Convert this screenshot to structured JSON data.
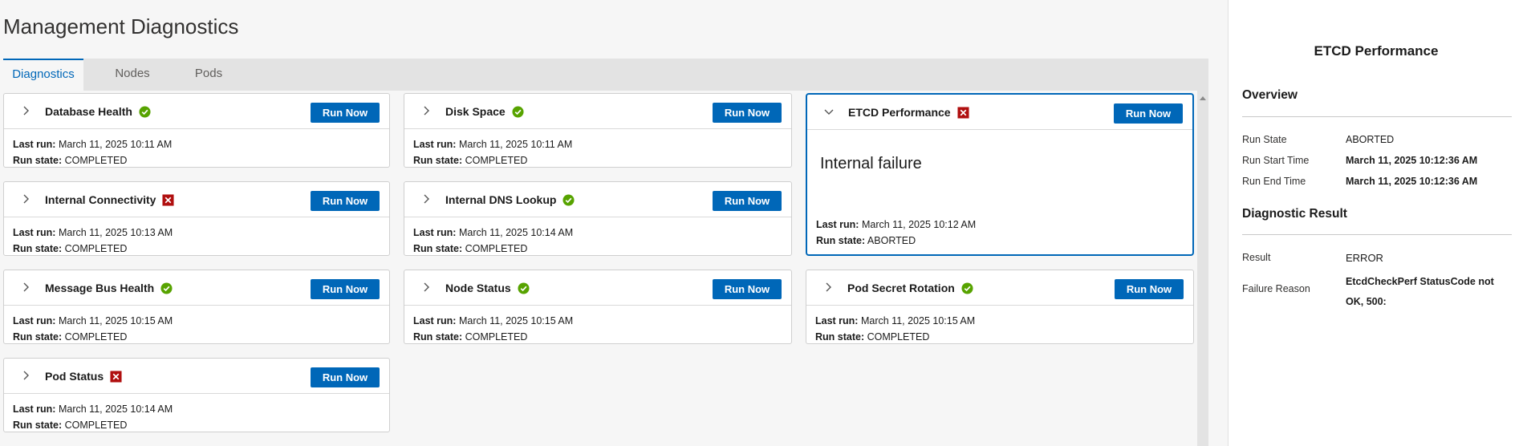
{
  "page": {
    "title": "Management Diagnostics"
  },
  "tabs": [
    {
      "label": "Diagnostics",
      "active": true
    },
    {
      "label": "Nodes",
      "active": false
    },
    {
      "label": "Pods",
      "active": false
    }
  ],
  "labels": {
    "last_run": "Last run:",
    "run_state": "Run state:",
    "run_now": "Run Now"
  },
  "colors": {
    "accent": "#0067b8",
    "success": "#57a300",
    "error": "#b00f0f"
  },
  "cards": [
    {
      "title": "Database Health",
      "status": "success",
      "last_run": "March 11, 2025 10:11 AM",
      "run_state": "COMPLETED",
      "expanded": false
    },
    {
      "title": "Disk Space",
      "status": "success",
      "last_run": "March 11, 2025 10:11 AM",
      "run_state": "COMPLETED",
      "expanded": false
    },
    {
      "title": "ETCD Performance",
      "status": "error",
      "last_run": "March 11, 2025 10:12 AM",
      "run_state": "ABORTED",
      "expanded": true,
      "message": "Internal failure"
    },
    {
      "title": "Internal Connectivity",
      "status": "error",
      "last_run": "March 11, 2025 10:13 AM",
      "run_state": "COMPLETED",
      "expanded": false
    },
    {
      "title": "Internal DNS Lookup",
      "status": "success",
      "last_run": "March 11, 2025 10:14 AM",
      "run_state": "COMPLETED",
      "expanded": false
    },
    {
      "title": "Message Bus Health",
      "status": "success",
      "last_run": "March 11, 2025 10:15 AM",
      "run_state": "COMPLETED",
      "expanded": false
    },
    {
      "title": "Node Status",
      "status": "success",
      "last_run": "March 11, 2025 10:15 AM",
      "run_state": "COMPLETED",
      "expanded": false
    },
    {
      "title": "Pod Secret Rotation",
      "status": "success",
      "last_run": "March 11, 2025 10:15 AM",
      "run_state": "COMPLETED",
      "expanded": false
    },
    {
      "title": "Pod Status",
      "status": "error",
      "last_run": "March 11, 2025 10:14 AM",
      "run_state": "COMPLETED",
      "expanded": false
    }
  ],
  "detail": {
    "title": "ETCD Performance",
    "overview_heading": "Overview",
    "overview": [
      {
        "label": "Run State",
        "value": "ABORTED"
      },
      {
        "label": "Run Start Time",
        "value": "March 11, 2025 10:12:36 AM"
      },
      {
        "label": "Run End Time",
        "value": "March 11, 2025 10:12:36 AM"
      }
    ],
    "result_heading": "Diagnostic Result",
    "result": [
      {
        "label": "Result",
        "value": "ERROR"
      },
      {
        "label": "Failure Reason",
        "value": "EtcdCheckPerf StatusCode not OK, 500:"
      }
    ]
  }
}
